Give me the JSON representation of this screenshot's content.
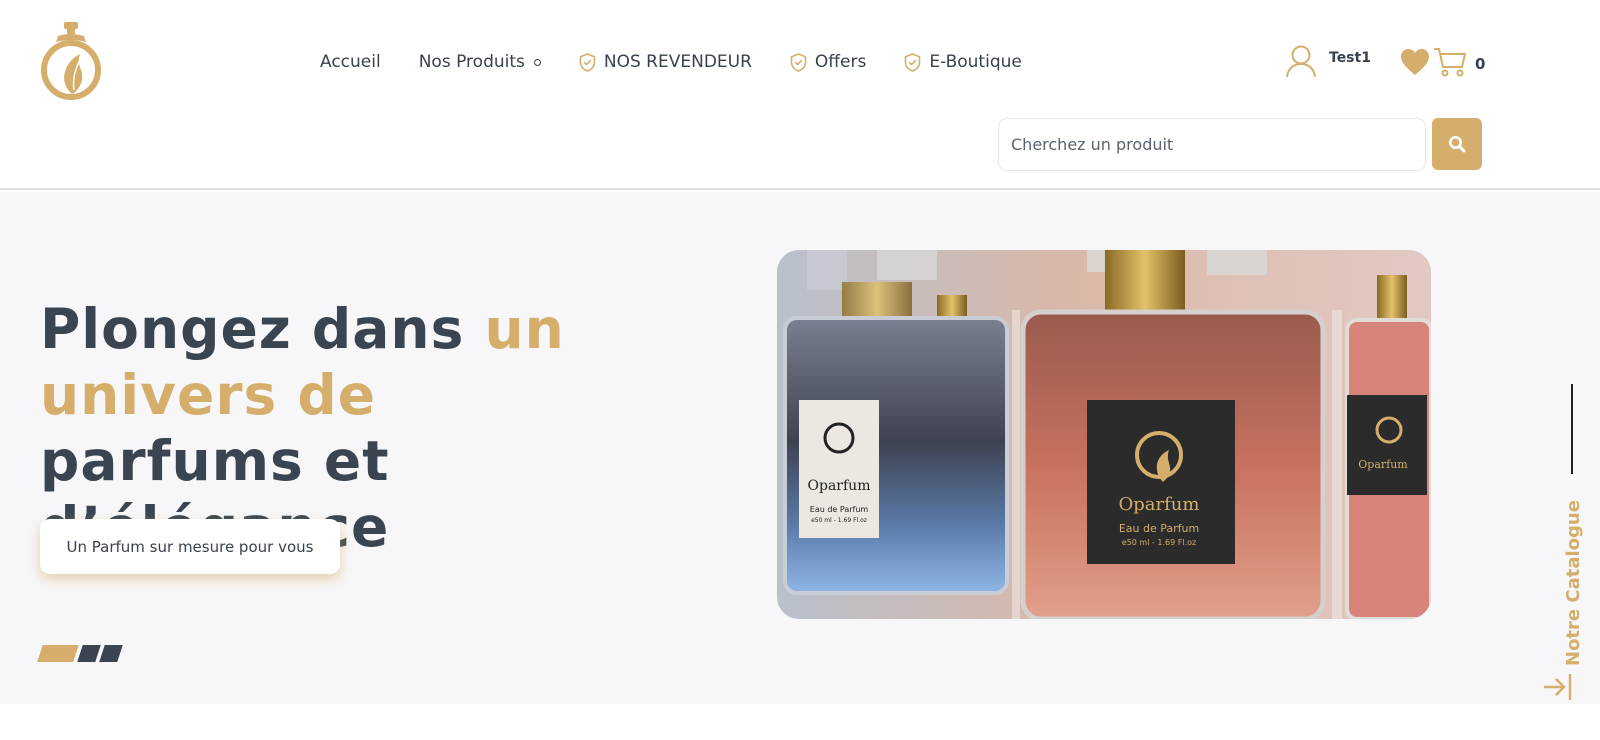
{
  "brand": {
    "logo_icon": "perfume-bottle-logo-icon",
    "accent_color": "#d4ae6a",
    "text_color": "#3a4551"
  },
  "nav": {
    "items": [
      {
        "label": "Accueil",
        "icon": null
      },
      {
        "label": "Nos Produits",
        "icon": "dot-indicator-icon"
      },
      {
        "label": "NOS REVENDEUR",
        "icon": "shield-check-icon"
      },
      {
        "label": "Offers",
        "icon": "shield-check-icon"
      },
      {
        "label": "E-Boutique",
        "icon": "shield-check-icon"
      }
    ]
  },
  "account": {
    "user_name": "Test1",
    "cart_count": "0"
  },
  "search": {
    "placeholder": "Cherchez un produit",
    "value": ""
  },
  "hero": {
    "title_part1": "Plongez dans ",
    "title_highlight": "un univers de",
    "title_part2": "parfums et d’élégance",
    "cta_label": "Un Parfum sur mesure pour vous",
    "slides_total": 3,
    "slide_active": 1,
    "image": {
      "bottle_brand": "Oparfum",
      "label_line1": "Eau de Parfum",
      "label_line2": "e50 ml - 1.69 Fl.oz"
    }
  },
  "side_tab": {
    "label": "Notre Catalogue"
  }
}
